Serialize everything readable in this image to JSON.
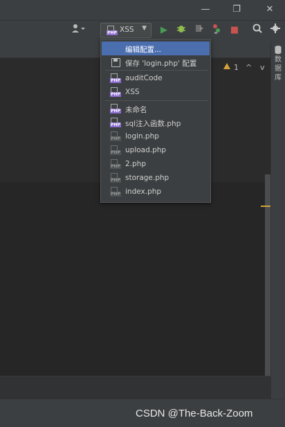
{
  "colors": {
    "accent": "#4b6eaf",
    "warning": "#d4a23b",
    "run": "#499c54",
    "debug": "#8fbc4f",
    "stop": "#c75450"
  },
  "window": {
    "minimize_icon": "—",
    "restore_icon": "❐",
    "close_icon": "✕"
  },
  "toolbar": {
    "user_icon": "user-icon",
    "run_config": {
      "label": "XSS",
      "icon": "php-sql-icon"
    },
    "run_icon": "▶",
    "debug_icon": "bug-icon",
    "coverage_icon": "coverage-icon",
    "profile_icon": "profile-icon",
    "stop_icon": "■",
    "search_icon": "search-icon",
    "settings_icon": "gear-icon"
  },
  "inspections": {
    "warning_count": "1",
    "up_arrow": "^",
    "down_arrow": "v"
  },
  "right_panel": {
    "database_label": "数据库"
  },
  "dropdown": {
    "items": [
      {
        "label": "编辑配置...",
        "icon": "none",
        "selected": true
      },
      {
        "label": "保存 'login.php' 配置",
        "icon": "save-icon"
      },
      {
        "label": "auditCode",
        "icon": "php-sql-icon"
      },
      {
        "label": "XSS",
        "icon": "php-sql-icon"
      },
      {
        "label": "未命名",
        "icon": "php-web-icon"
      },
      {
        "label": "sql注入函数.php",
        "icon": "php-web-icon"
      },
      {
        "label": "login.php",
        "icon": "php-web-dim-icon"
      },
      {
        "label": "upload.php",
        "icon": "php-web-dim-icon"
      },
      {
        "label": "2.php",
        "icon": "php-web-dim-icon"
      },
      {
        "label": "storage.php",
        "icon": "php-web-dim-icon"
      },
      {
        "label": "index.php",
        "icon": "php-web-dim-icon"
      }
    ]
  },
  "watermark": "CSDN @The-Back-Zoom"
}
